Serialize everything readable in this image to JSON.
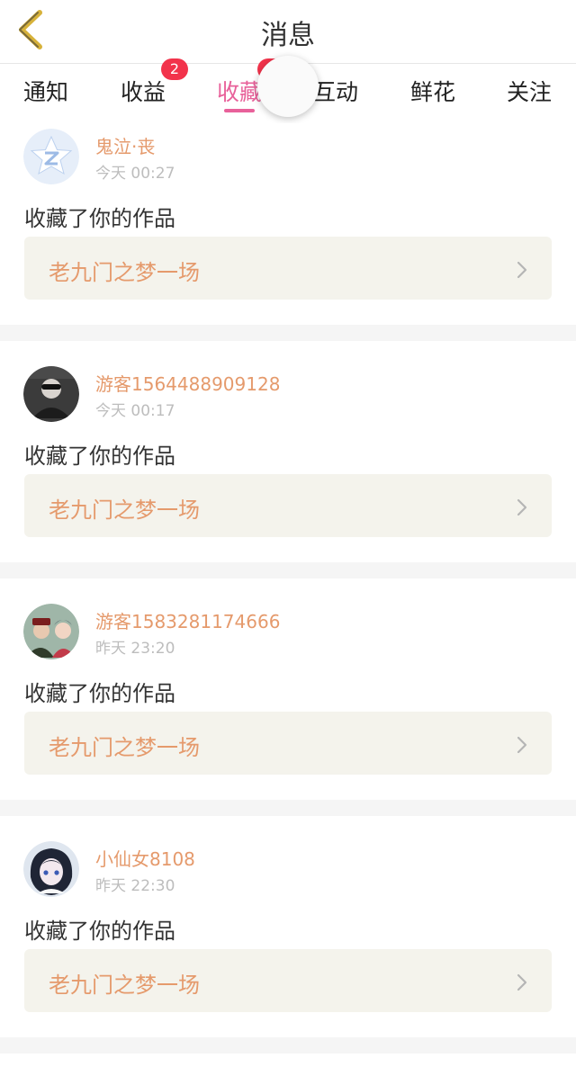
{
  "header": {
    "title": "消息",
    "back_icon": "chevron-left-icon"
  },
  "tabs": [
    {
      "label": "通知",
      "active": false,
      "badge": ""
    },
    {
      "label": "收益",
      "active": false,
      "badge": "2"
    },
    {
      "label": "收藏",
      "active": true,
      "badge": ""
    },
    {
      "label": "互动",
      "active": false,
      "badge": ""
    },
    {
      "label": "鲜花",
      "active": false,
      "badge": ""
    },
    {
      "label": "关注",
      "active": false,
      "badge": ""
    }
  ],
  "colors": {
    "accent": "#e8619a",
    "name": "#e59a6c",
    "badge": "#f2334b",
    "work_bg": "#f4f3ec"
  },
  "messages": [
    {
      "name": "鬼泣·丧",
      "time": "今天 00:27",
      "action": "收藏了你的作品",
      "work": "老九门之梦一场",
      "avatar": "qzone-star-avatar"
    },
    {
      "name": "游客1564488909128",
      "time": "今天 00:17",
      "action": "收藏了你的作品",
      "work": "老九门之梦一场",
      "avatar": "photo-avatar"
    },
    {
      "name": "游客1583281174666",
      "time": "昨天 23:20",
      "action": "收藏了你的作品",
      "work": "老九门之梦一场",
      "avatar": "photo-avatar"
    },
    {
      "name": "小仙女8108",
      "time": "昨天 22:30",
      "action": "收藏了你的作品",
      "work": "老九门之梦一场",
      "avatar": "anime-avatar"
    }
  ]
}
